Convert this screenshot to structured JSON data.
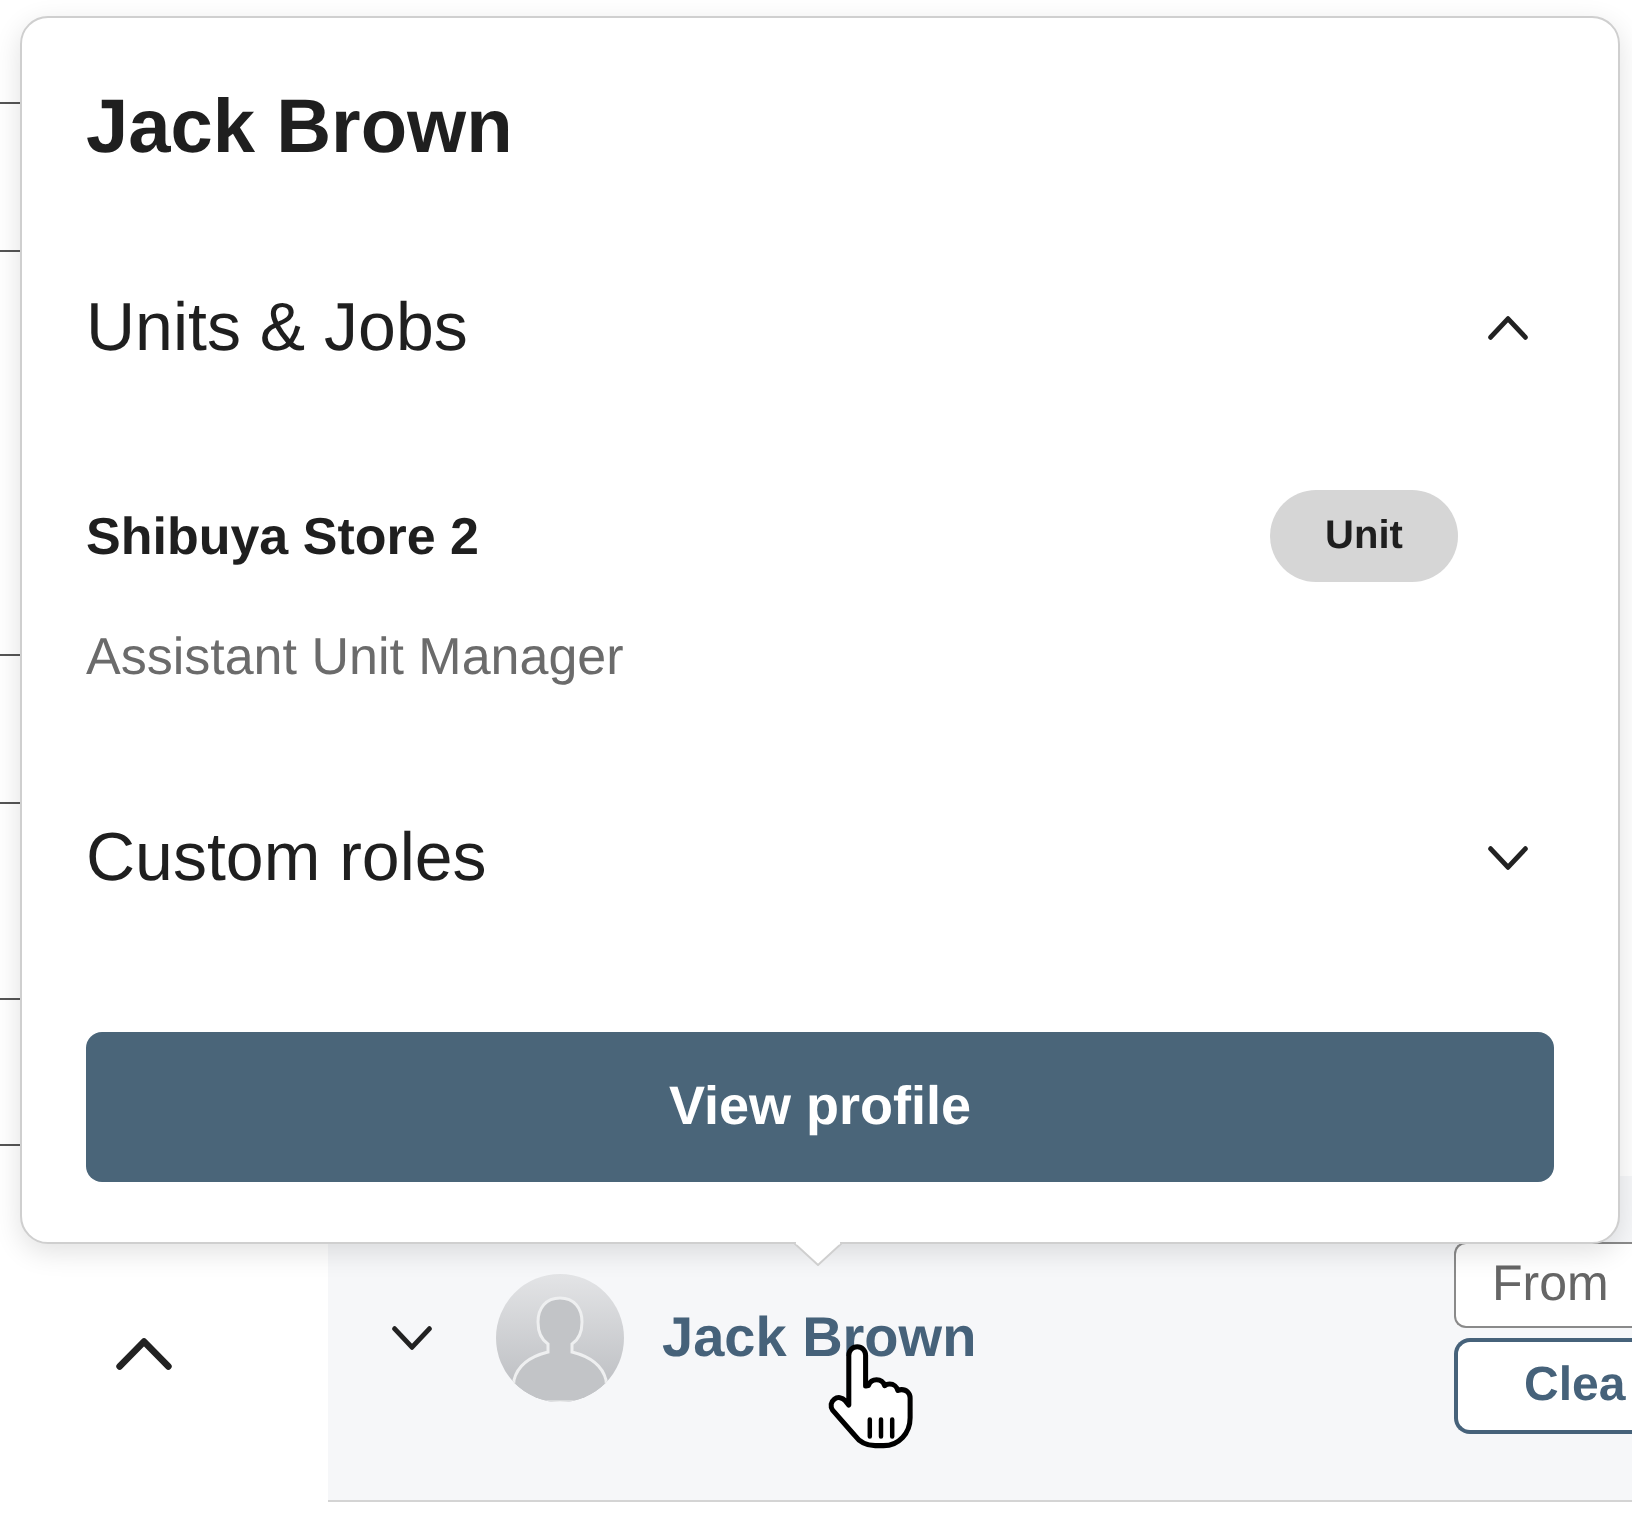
{
  "popover": {
    "title": "Jack Brown",
    "sections": [
      {
        "heading": "Units & Jobs",
        "expanded": true,
        "items": [
          {
            "name": "Shibuya Store 2",
            "badge": "Unit",
            "role": "Assistant Unit Manager"
          }
        ]
      },
      {
        "heading": "Custom roles",
        "expanded": false
      }
    ],
    "button": "View profile"
  },
  "side_toggle": {
    "expanded": true
  },
  "row": {
    "expanded": false,
    "name": "Jack Brown",
    "field": {
      "placeholder": "From"
    },
    "button": "Clea"
  }
}
